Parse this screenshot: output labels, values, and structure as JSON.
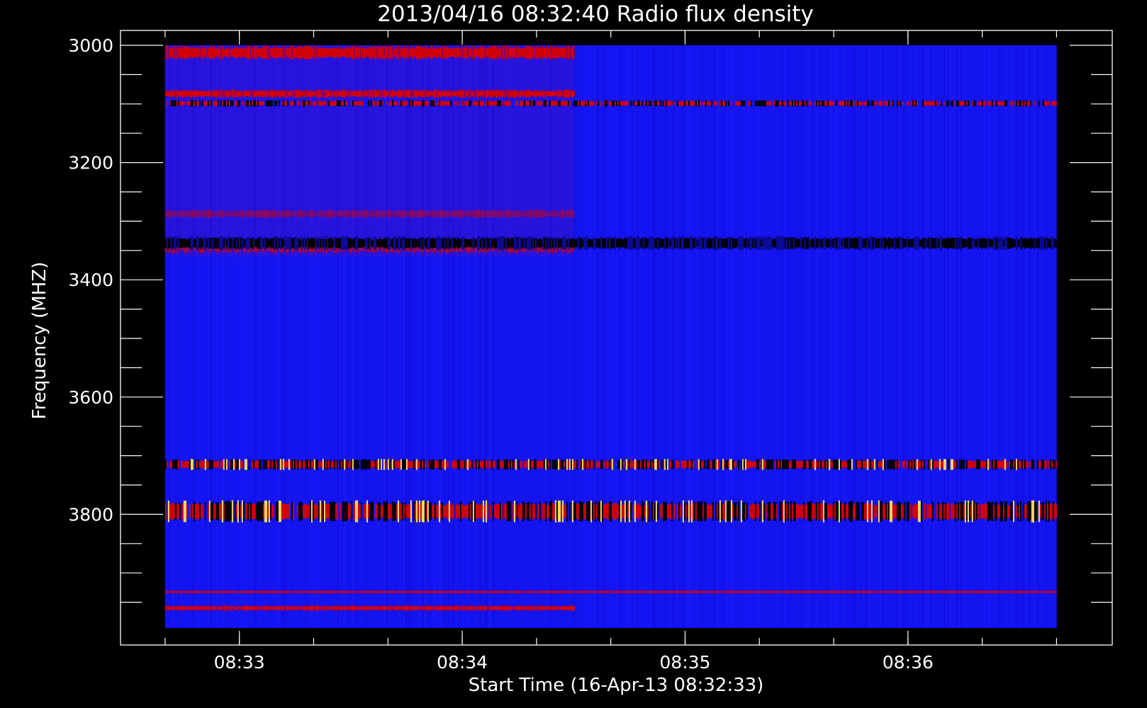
{
  "chart_data": {
    "type": "heatmap",
    "title": "2013/04/16 08:32:40 Radio flux density",
    "xlabel": "Start Time (16-Apr-13 08:32:33)",
    "ylabel": "Frequency (MHZ)",
    "x_start": "08:32:40",
    "x_end": "08:36:40",
    "xlim": [
      "08:32:28",
      "08:36:55"
    ],
    "ylim": [
      3000,
      4000
    ],
    "y_inverted": true,
    "x_tick_labels": [
      "08:33",
      "08:34",
      "08:35",
      "08:36"
    ],
    "y_tick_labels": [
      "3000",
      "3200",
      "3400",
      "3600",
      "3800"
    ],
    "grid": false,
    "legend": "none",
    "colors": {
      "background": "#000000",
      "axes": "#ffffff",
      "base": "#1414f0",
      "low": "#000000",
      "high": "#d80000",
      "peak": "#ffe060"
    },
    "bands": [
      {
        "freq": [
          3000,
          3025
        ],
        "intensity": "high",
        "time_extent": "08:34:30"
      },
      {
        "freq": [
          3075,
          3090
        ],
        "intensity": "high",
        "time_extent": "08:34:30"
      },
      {
        "freq": [
          3093,
          3105
        ],
        "intensity": "mixed",
        "time_extent": "08:36:40"
      },
      {
        "freq": [
          3280,
          3295
        ],
        "intensity": "faint",
        "time_extent": "08:34:30"
      },
      {
        "freq": [
          3330,
          3355
        ],
        "intensity": "faint-high",
        "time_extent": "08:34:30"
      },
      {
        "freq": [
          3325,
          3350
        ],
        "intensity": "low",
        "time_extent": "08:36:40"
      },
      {
        "freq": [
          3705,
          3725
        ],
        "intensity": "high-peak",
        "time_extent": "08:36:40"
      },
      {
        "freq": [
          3775,
          3815
        ],
        "intensity": "high-peak",
        "time_extent": "08:36:40"
      },
      {
        "freq": [
          3930,
          3935
        ],
        "intensity": "high",
        "time_extent": "08:36:40"
      },
      {
        "freq": [
          3955,
          3965
        ],
        "intensity": "high",
        "time_extent": "08:34:30"
      }
    ]
  }
}
